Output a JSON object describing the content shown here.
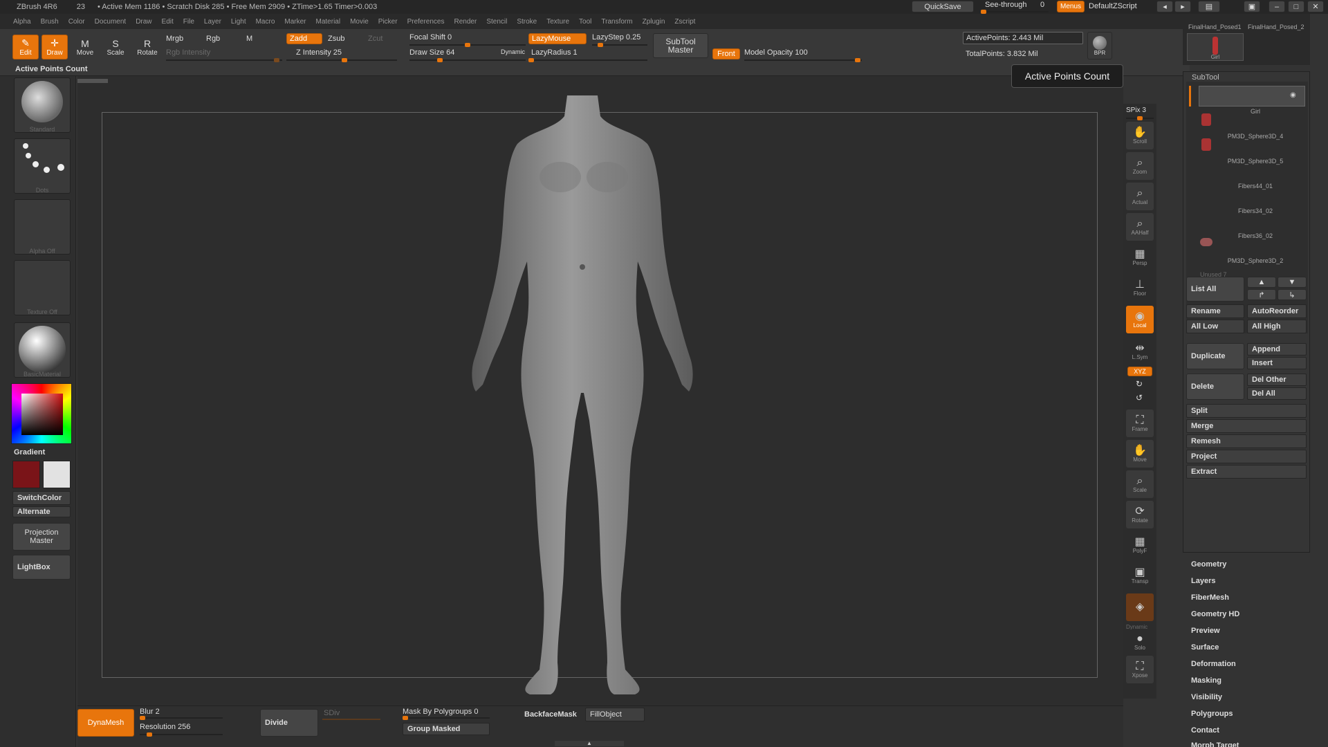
{
  "titlebar": {
    "app": "ZBrush 4R6",
    "count": "23",
    "stats": "• Active Mem 1186 • Scratch Disk 285 • Free Mem 2909 • ZTime>1.65 Timer>0.003",
    "quicksave": "QuickSave",
    "see_through": "See-through",
    "see_through_value": "0",
    "menus": "Menus",
    "script": "DefaultZScript"
  },
  "menubar": {
    "items": [
      "Alpha",
      "Brush",
      "Color",
      "Document",
      "Draw",
      "Edit",
      "File",
      "Layer",
      "Light",
      "Macro",
      "Marker",
      "Material",
      "Movie",
      "Picker",
      "Preferences",
      "Render",
      "Stencil",
      "Stroke",
      "Texture",
      "Tool",
      "Transform",
      "Zplugin",
      "Zscript"
    ]
  },
  "toolbar": {
    "edit": "Edit",
    "draw": "Draw",
    "move": "Move",
    "scale": "Scale",
    "rotate": "Rotate",
    "mrgb": "Mrgb",
    "rgb": "Rgb",
    "m": "M",
    "rgb_intensity": "Rgb Intensity",
    "zadd": "Zadd",
    "zsub": "Zsub",
    "zcut": "Zcut",
    "z_intensity": "Z Intensity 25",
    "focal_shift": "Focal Shift 0",
    "draw_size": "Draw Size 64",
    "dynamic": "Dynamic",
    "lazymouse": "LazyMouse",
    "lazystep": "LazyStep 0.25",
    "lazyradius": "LazyRadius 1",
    "subtool_master": "SubTool Master",
    "front": "Front",
    "model_opacity": "Model Opacity 100",
    "active_points": "ActivePoints: 2.443 Mil",
    "total_points": "TotalPoints: 3.832 Mil",
    "bpr": "BPR"
  },
  "left": {
    "active_points_label": "Active Points Count",
    "brush": "Standard",
    "stroke": "Dots",
    "alpha": "Alpha Off",
    "texture": "Texture Off",
    "material": "BasicMaterial",
    "gradient": "Gradient",
    "switchcolor": "SwitchColor",
    "alternate": "Alternate",
    "projection_master": "Projection Master",
    "lightbox": "LightBox"
  },
  "right_shelf": {
    "spix": "SPix 3",
    "items": [
      "Scroll",
      "Zoom",
      "Actual",
      "AAHalf",
      "Persp",
      "Floor",
      "Local",
      "L.Sym",
      "XYZ",
      "Frame",
      "Move",
      "Scale",
      "Rotate",
      "PolyF",
      "Transp",
      "Dynamic",
      "Solo",
      "Xpose"
    ]
  },
  "tooltip": "Active Points Count",
  "tool_thumbs": [
    "FinalHand_Posed1",
    "FinalHand_Posed_2",
    "Girl"
  ],
  "subtool": {
    "title": "SubTool",
    "items": [
      "Girl",
      "PM3D_Sphere3D_4",
      "PM3D_Sphere3D_5",
      "Fibers44_01",
      "Fibers34_02",
      "Fibers36_02",
      "PM3D_Sphere3D_2"
    ],
    "unused": "Unused 7",
    "list_all": "List All",
    "rename": "Rename",
    "autoreorder": "AutoReorder",
    "all_low": "All Low",
    "all_high": "All High",
    "duplicate": "Duplicate",
    "append": "Append",
    "insert": "Insert",
    "delete": "Delete",
    "del_other": "Del Other",
    "del_all": "Del All",
    "split": "Split",
    "merge": "Merge",
    "remesh": "Remesh",
    "project": "Project",
    "extract": "Extract"
  },
  "tool_menus": [
    "Geometry",
    "Layers",
    "FiberMesh",
    "Geometry HD",
    "Preview",
    "Surface",
    "Deformation",
    "Masking",
    "Visibility",
    "Polygroups",
    "Contact",
    "Morph Target"
  ],
  "bottom": {
    "dynamesh": "DynaMesh",
    "blur": "Blur 2",
    "resolution": "Resolution 256",
    "divide": "Divide",
    "sdiv": "SDiv",
    "mask_by_polygroups": "Mask By Polygroups 0",
    "group_masked": "Group Masked",
    "backfacemask": "BackfaceMask",
    "fillobject": "FillObject"
  }
}
